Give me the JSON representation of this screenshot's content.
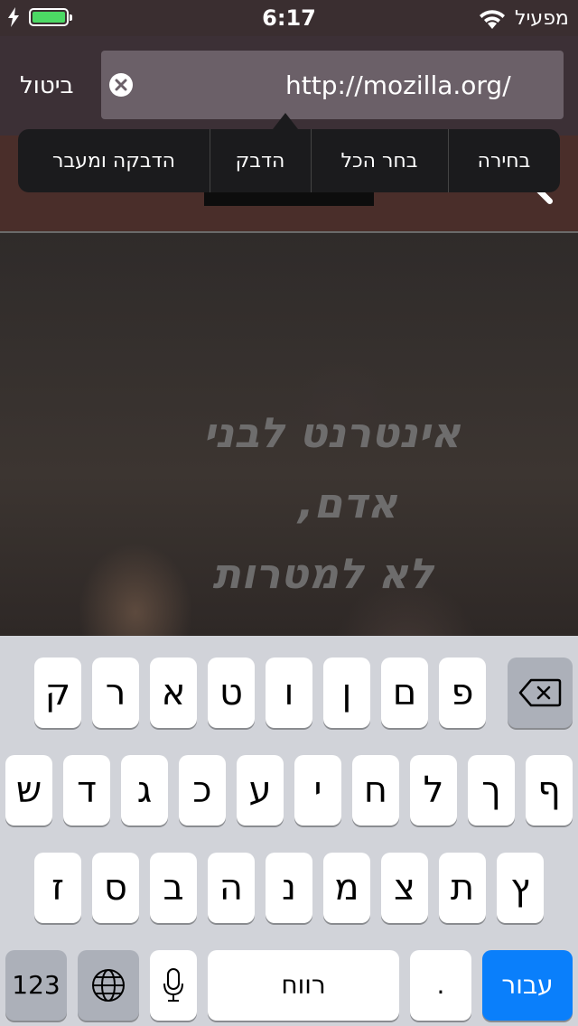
{
  "status_bar": {
    "time": "6:17",
    "carrier": "מפעיל",
    "battery_color": "#4cd964"
  },
  "url_bar": {
    "cancel_label": "ביטול",
    "url": "http://mozilla.org/"
  },
  "edit_menu": {
    "items": [
      "בחירה",
      "בחר הכל",
      "הדבק",
      "הדבקה ומעבר"
    ]
  },
  "page": {
    "hero_line1": "אינטרנט לבני",
    "hero_line2": "אדם,",
    "hero_line3": "לא למטרות"
  },
  "keyboard": {
    "row1": [
      "ק",
      "ר",
      "א",
      "ט",
      "ו",
      "ן",
      "ם",
      "פ"
    ],
    "row2": [
      "ש",
      "ד",
      "ג",
      "כ",
      "ע",
      "י",
      "ח",
      "ל",
      "ך",
      "ף"
    ],
    "row3": [
      "ז",
      "ס",
      "ב",
      "ה",
      "נ",
      "מ",
      "צ",
      "ת",
      "ץ"
    ],
    "numbers_label": "123",
    "space_label": "רווח",
    "period_label": ".",
    "go_label": "עבור",
    "icons": [
      "backspace-icon",
      "globe-icon",
      "microphone-icon"
    ],
    "go_color": "#0a7ffb"
  }
}
